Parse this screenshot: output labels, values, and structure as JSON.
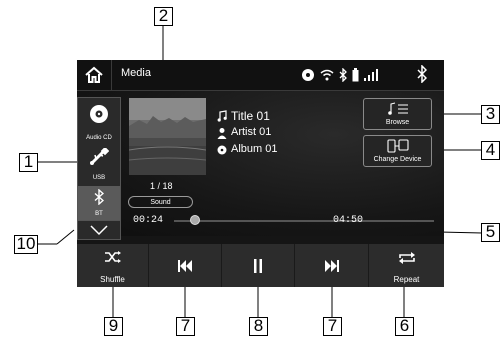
{
  "header": {
    "title": "Media"
  },
  "sources": [
    {
      "label": "Audio CD",
      "icon": "cd-icon"
    },
    {
      "label": "USB",
      "icon": "usb-icon"
    },
    {
      "label": "BT",
      "icon": "bluetooth-icon"
    }
  ],
  "track": {
    "title": "Title 01",
    "artist": "Artist 01",
    "album": "Album 01",
    "count": "1 / 18",
    "elapsed": "00:24",
    "duration": "04:50",
    "progress_fraction": 0.08
  },
  "sound_label": "Sound",
  "side_buttons": {
    "browse": "Browse",
    "change_device": "Change Device"
  },
  "controls": {
    "shuffle": "Shuffle",
    "repeat": "Repeat"
  },
  "callouts": {
    "c1": "1",
    "c2": "2",
    "c3": "3",
    "c4": "4",
    "c5": "5",
    "c6": "6",
    "c7a": "7",
    "c7b": "7",
    "c8": "8",
    "c9": "9",
    "c10": "10"
  }
}
